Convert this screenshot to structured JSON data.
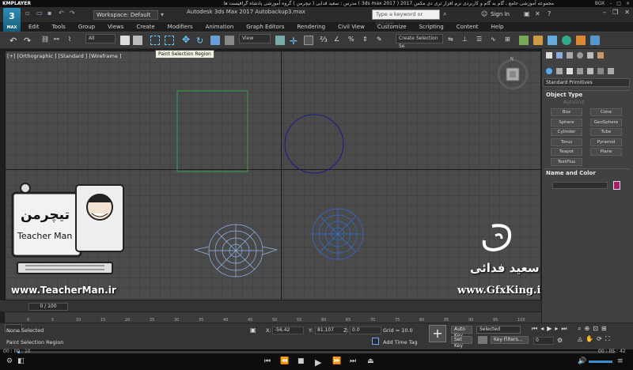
{
  "kmplayer": {
    "logo": "KMPLAYER",
    "movie_title": "مجموعه آموزشی جامع ، گام به گام و کاربردی نرم افزار تری دی مکس 2017 ( 3ds max 2017 )   مدرس : سعید فدایی ( تیچرمن ) گروه آموزشی پادشاه گرافیست ها",
    "window_label": "BOX"
  },
  "titlebar": {
    "app_logo_number": "3",
    "app_logo_sub": "MAX",
    "workspace": "Workspace: Default",
    "window_title": "Autodesk 3ds Max 2017    Autobackup3.max",
    "search_placeholder": "Type a keyword or phrase",
    "sign_in": "Sign In"
  },
  "menu": [
    "Edit",
    "Tools",
    "Group",
    "Views",
    "Create",
    "Modifiers",
    "Animation",
    "Graph Editors",
    "Rendering",
    "Civil View",
    "Customize",
    "Scripting",
    "Content",
    "Help"
  ],
  "toolbar": {
    "filter_dropdown": "All",
    "view_dropdown": "View",
    "selection_set": "Create Selection Se",
    "tooltip": "Paint Selection Region"
  },
  "viewport": {
    "label": "[+] [Orthographic ] [Standard ] [Wireframe ]"
  },
  "command_panel": {
    "category": "Standard Primitives",
    "object_type_title": "Object Type",
    "autogrid": "AutoGrid",
    "buttons": [
      "Box",
      "Cone",
      "Sphere",
      "GeoSphere",
      "Cylinder",
      "Tube",
      "Torus",
      "Pyramid",
      "Teapot",
      "Plane",
      "TextPlus"
    ],
    "name_color_title": "Name and Color",
    "object_color": "#b01c6c"
  },
  "timeline": {
    "slider": "0 / 100",
    "ticks": [
      "0",
      "5",
      "10",
      "15",
      "20",
      "25",
      "30",
      "35",
      "40",
      "45",
      "50",
      "55",
      "60",
      "65",
      "70",
      "75",
      "80",
      "85",
      "90",
      "95",
      "100"
    ]
  },
  "status": {
    "selection": "None Selected",
    "prompt": "Paint Selection Region",
    "x_label": "X:",
    "x_value": "-56.42",
    "y_label": "Y:",
    "y_value": "81.107",
    "z_label": "Z:",
    "z_value": "0.0",
    "grid": "Grid = 10.0",
    "add_time_tag": "Add Time Tag",
    "auto_key": "Auto Key",
    "set_key": "Set Key",
    "selected_dropdown": "Selected",
    "key_filters": "Key Filters...",
    "frame": "0"
  },
  "player": {
    "elapsed": "00 : 00 : 10",
    "total": "00 : 05 : 42"
  },
  "overlays": {
    "teacherman_brand": "تیچرمن",
    "teacherman_name": "Teacher Man",
    "teacherman_url": "www.TeacherMan.ir",
    "instructor_fa": "سعید فدائی",
    "gfxking_url": "www.GfxKing.ir"
  },
  "colors": {
    "rectangle_wire": "#2fa04a",
    "circle_wire": "#1a1a8a",
    "mesh_wire": "#2f6fd8",
    "accent_blue": "#1e88c8"
  }
}
